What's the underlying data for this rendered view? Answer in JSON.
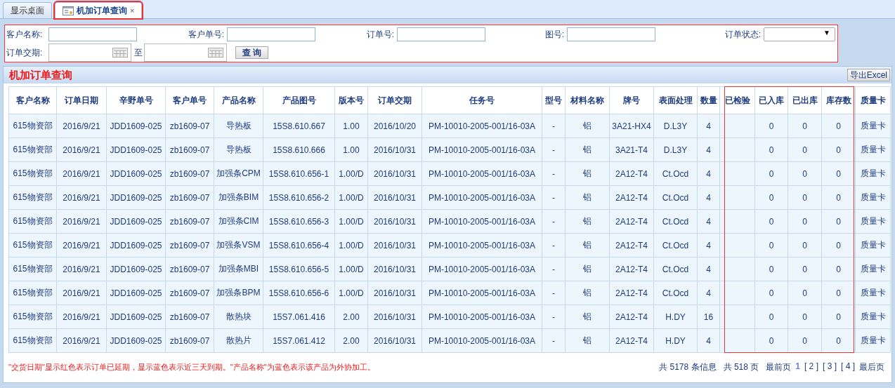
{
  "tabs": [
    {
      "label": "显示桌面",
      "selected": false
    },
    {
      "label": "机加订单查询",
      "selected": true,
      "close": "×"
    }
  ],
  "filters": {
    "customer_name": {
      "label": "客户名称:"
    },
    "customer_order_no": {
      "label": "客户单号:"
    },
    "order_no": {
      "label": "订单号:"
    },
    "drawing_no": {
      "label": "图号:"
    },
    "order_status": {
      "label": "订单状态:",
      "arrow": "▼"
    },
    "delivery_date": {
      "label": "订单交期:",
      "to": "至"
    },
    "search_button": "查 询"
  },
  "panel": {
    "title": "机加订单查询",
    "export_button": "导出Excel"
  },
  "table": {
    "columns": [
      "客户名称",
      "订单日期",
      "辛野单号",
      "客户单号",
      "产品名称",
      "产品图号",
      "版本号",
      "订单交期",
      "任务号",
      "型号",
      "材料名称",
      "牌号",
      "表面处理",
      "数量",
      "已检验",
      "已入库",
      "已出库",
      "库存数",
      "质量卡"
    ],
    "rows": [
      {
        "customer": "615物资部",
        "order_date": "2016/9/21",
        "xinye_no": "JDD1609-025",
        "customer_no": "zb1609-07",
        "product": "导热板",
        "drawing": "15S8.610.667",
        "version": "1.00",
        "delivery": "2016/10/20",
        "task": "PM-10010-2005-001/16-03A",
        "model": "-",
        "material": "铝",
        "grade": "3A21-HX4",
        "surface": "D.L3Y",
        "qty": "4",
        "stored": "0",
        "shipped": "0",
        "stock": "0",
        "quality": "质量卡"
      },
      {
        "customer": "615物资部",
        "order_date": "2016/9/21",
        "xinye_no": "JDD1609-025",
        "customer_no": "zb1609-07",
        "product": "导热板",
        "drawing": "15S8.610.666",
        "version": "1.00",
        "delivery": "2016/10/31",
        "task": "PM-10010-2005-001/16-03A",
        "model": "-",
        "material": "铝",
        "grade": "3A21-T4",
        "surface": "D.L3Y",
        "qty": "4",
        "stored": "0",
        "shipped": "0",
        "stock": "0",
        "quality": "质量卡"
      },
      {
        "customer": "615物资部",
        "order_date": "2016/9/21",
        "xinye_no": "JDD1609-025",
        "customer_no": "zb1609-07",
        "product": "加强条CPM",
        "drawing": "15S8.610.656-1",
        "version": "1.00/D",
        "delivery": "2016/10/31",
        "task": "PM-10010-2005-001/16-03A",
        "model": "-",
        "material": "铝",
        "grade": "2A12-T4",
        "surface": "Ct.Ocd",
        "qty": "4",
        "stored": "0",
        "shipped": "0",
        "stock": "0",
        "quality": "质量卡"
      },
      {
        "customer": "615物资部",
        "order_date": "2016/9/21",
        "xinye_no": "JDD1609-025",
        "customer_no": "zb1609-07",
        "product": "加强条BIM",
        "drawing": "15S8.610.656-2",
        "version": "1.00/D",
        "delivery": "2016/10/31",
        "task": "PM-10010-2005-001/16-03A",
        "model": "-",
        "material": "铝",
        "grade": "2A12-T4",
        "surface": "Ct.Ocd",
        "qty": "4",
        "stored": "0",
        "shipped": "0",
        "stock": "0",
        "quality": "质量卡"
      },
      {
        "customer": "615物资部",
        "order_date": "2016/9/21",
        "xinye_no": "JDD1609-025",
        "customer_no": "zb1609-07",
        "product": "加强条CIM",
        "drawing": "15S8.610.656-3",
        "version": "1.00/D",
        "delivery": "2016/10/31",
        "task": "PM-10010-2005-001/16-03A",
        "model": "-",
        "material": "铝",
        "grade": "2A12-T4",
        "surface": "Ct.Ocd",
        "qty": "4",
        "stored": "0",
        "shipped": "0",
        "stock": "0",
        "quality": "质量卡"
      },
      {
        "customer": "615物资部",
        "order_date": "2016/9/21",
        "xinye_no": "JDD1609-025",
        "customer_no": "zb1609-07",
        "product": "加强条VSM",
        "drawing": "15S8.610.656-4",
        "version": "1.00/D",
        "delivery": "2016/10/31",
        "task": "PM-10010-2005-001/16-03A",
        "model": "-",
        "material": "铝",
        "grade": "2A12-T4",
        "surface": "Ct.Ocd",
        "qty": "4",
        "stored": "0",
        "shipped": "0",
        "stock": "0",
        "quality": "质量卡"
      },
      {
        "customer": "615物资部",
        "order_date": "2016/9/21",
        "xinye_no": "JDD1609-025",
        "customer_no": "zb1609-07",
        "product": "加强条MBI",
        "drawing": "15S8.610.656-5",
        "version": "1.00/D",
        "delivery": "2016/10/31",
        "task": "PM-10010-2005-001/16-03A",
        "model": "-",
        "material": "铝",
        "grade": "2A12-T4",
        "surface": "Ct.Ocd",
        "qty": "4",
        "stored": "0",
        "shipped": "0",
        "stock": "0",
        "quality": "质量卡"
      },
      {
        "customer": "615物资部",
        "order_date": "2016/9/21",
        "xinye_no": "JDD1609-025",
        "customer_no": "zb1609-07",
        "product": "加强条BPM",
        "drawing": "15S8.610.656-6",
        "version": "1.00/D",
        "delivery": "2016/10/31",
        "task": "PM-10010-2005-001/16-03A",
        "model": "-",
        "material": "铝",
        "grade": "2A12-T4",
        "surface": "Ct.Ocd",
        "qty": "4",
        "stored": "0",
        "shipped": "0",
        "stock": "0",
        "quality": "质量卡"
      },
      {
        "customer": "615物资部",
        "order_date": "2016/9/21",
        "xinye_no": "JDD1609-025",
        "customer_no": "zb1609-07",
        "product": "散热块",
        "drawing": "15S7.061.416",
        "version": "2.00",
        "delivery": "2016/10/31",
        "task": "PM-10010-2005-001/16-03A",
        "model": "-",
        "material": "铝",
        "grade": "2A12-T4",
        "surface": "H.DY",
        "qty": "16",
        "stored": "0",
        "shipped": "0",
        "stock": "0",
        "quality": "质量卡"
      },
      {
        "customer": "615物资部",
        "order_date": "2016/9/21",
        "xinye_no": "JDD1609-025",
        "customer_no": "zb1609-07",
        "product": "散热片",
        "drawing": "15S7.061.412",
        "version": "2.00",
        "delivery": "2016/10/31",
        "task": "PM-10010-2005-001/16-03A",
        "model": "-",
        "material": "铝",
        "grade": "2A12-T4",
        "surface": "H.DY",
        "qty": "4",
        "stored": "0",
        "shipped": "0",
        "stock": "0",
        "quality": "质量卡"
      }
    ]
  },
  "note": "\"交货日期\"显示红色表示订单已延期，显示蓝色表示近三天到期。\"产品名称\"为蓝色表示该产品为外协加工。",
  "pager": {
    "total_records": "共 5178 条信息",
    "total_pages": "共 518 页",
    "first": "最前页",
    "pages": [
      {
        "label": "1",
        "selected": true
      },
      {
        "label": "[ 2 ]",
        "selected": false
      },
      {
        "label": "[ 3 ]",
        "selected": false
      },
      {
        "label": "[ 4 ]",
        "selected": false
      }
    ],
    "last": "最后页"
  }
}
